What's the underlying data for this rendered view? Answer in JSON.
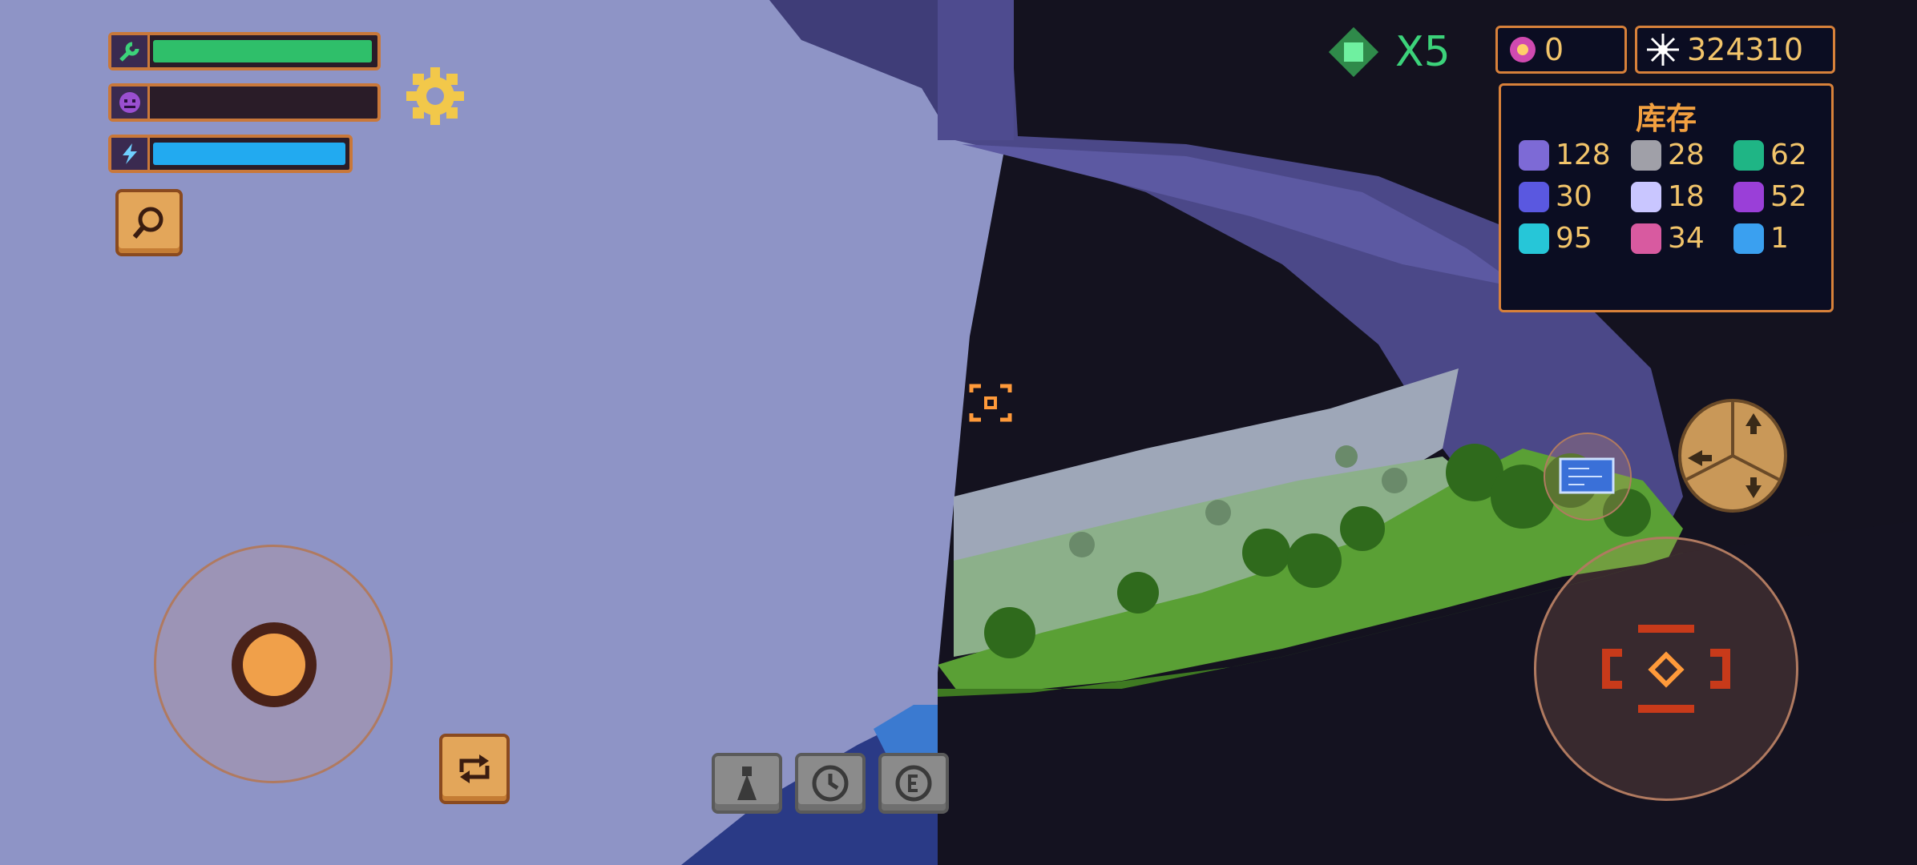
{
  "hud": {
    "bars": [
      {
        "name": "health",
        "icon": "wrench-icon",
        "fill_fraction": 0.96,
        "color": "#2fbf6a"
      },
      {
        "name": "rage",
        "icon": "demon-face-icon",
        "fill_fraction": 0.0,
        "color": "#7a3fb0"
      },
      {
        "name": "energy",
        "icon": "lightning-icon",
        "fill_fraction": 0.98,
        "color": "#22aaf0"
      }
    ]
  },
  "top_right": {
    "multiplier_label": "X5",
    "gem_count": "0",
    "score": "324310"
  },
  "inventory": {
    "title": "库存",
    "items": [
      {
        "icon": "purple-ore-icon",
        "count": "128",
        "color": "#7d6ad6"
      },
      {
        "icon": "grey-shard-icon",
        "count": "28",
        "color": "#a0a0a8"
      },
      {
        "icon": "green-crystal-icon",
        "count": "62",
        "color": "#1fb585"
      },
      {
        "icon": "blue-cluster-icon",
        "count": "30",
        "color": "#5a58e0"
      },
      {
        "icon": "star-spark-icon",
        "count": "18",
        "color": "#c9c6ff"
      },
      {
        "icon": "violet-crystal-icon",
        "count": "52",
        "color": "#9a3fd8"
      },
      {
        "icon": "cyan-orb-icon",
        "count": "95",
        "color": "#26c6d8"
      },
      {
        "icon": "pink-vine-icon",
        "count": "34",
        "color": "#d85aa0"
      },
      {
        "icon": "blue-cube-icon",
        "count": "1",
        "color": "#3aa0f0"
      }
    ]
  },
  "colors": {
    "sky": "#8e94c6",
    "accent_orange": "#d8813a",
    "gold_text": "#f2c46a",
    "multiplier_green": "#3cd27a"
  }
}
